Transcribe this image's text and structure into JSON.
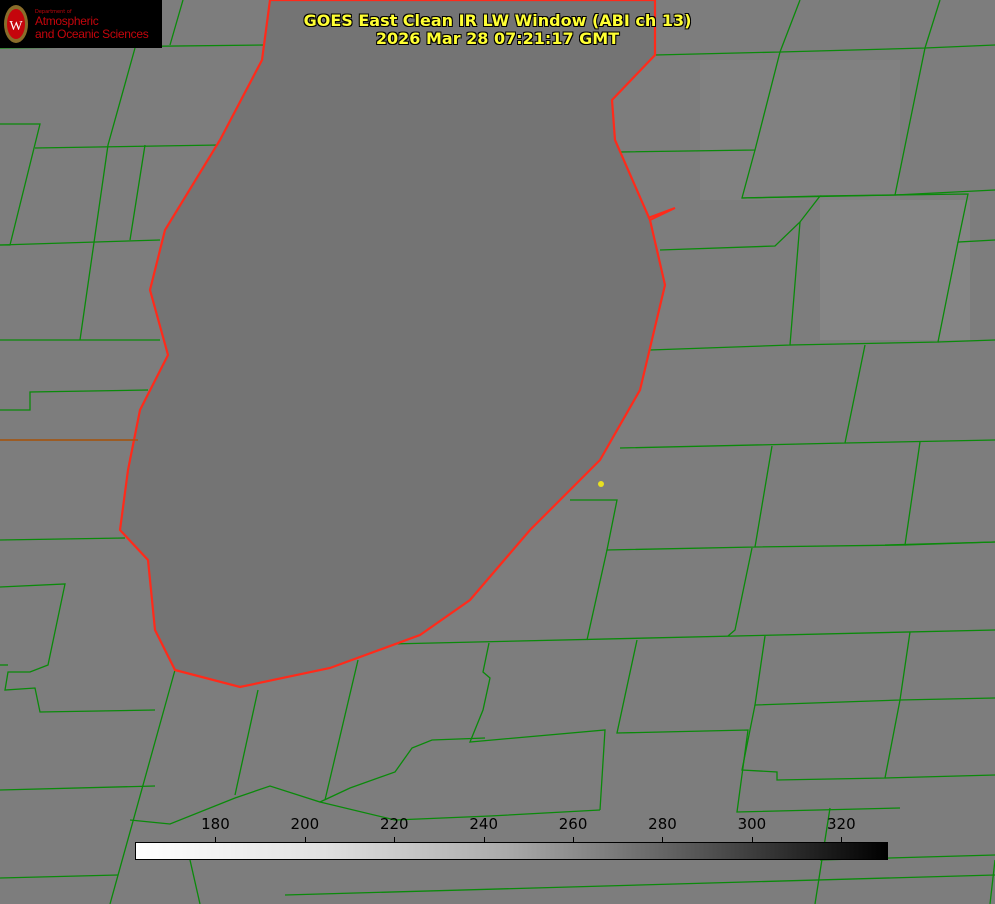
{
  "logo": {
    "dept": "Department of",
    "line1": "Atmospheric",
    "line2": "and Oceanic Sciences",
    "letter": "W"
  },
  "title": {
    "line1": "GOES East Clean IR LW Window (ABI ch 13)",
    "line2": "2026 Mar 28 07:21:17 GMT"
  },
  "colorbar": {
    "min": 162,
    "max": 330,
    "ticks": [
      "180",
      "200",
      "220",
      "240",
      "260",
      "280",
      "300",
      "320"
    ],
    "tick_values": [
      180,
      200,
      220,
      240,
      260,
      280,
      300,
      320
    ]
  },
  "colors": {
    "lake_outline": "#ff2a1a",
    "county_lines": "#0a8a0a",
    "title": "#ffff33",
    "marker": "#e8e020"
  }
}
